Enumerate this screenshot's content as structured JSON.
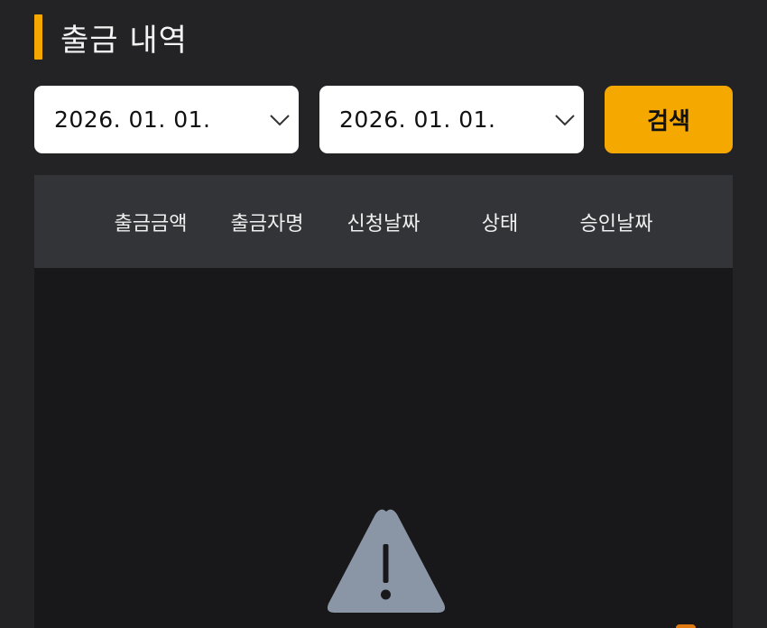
{
  "header": {
    "title": "출금 내역",
    "accent_color": "#f5a800"
  },
  "filters": {
    "start_date": "2026. 01. 01.",
    "end_date": "2026. 01. 01.",
    "dropdown_icon": "chevron-down-icon",
    "search_label": "검색"
  },
  "table": {
    "columns": [
      "출금금액",
      "출금자명",
      "신청날짜",
      "상태",
      "승인날짜"
    ],
    "rows": [],
    "empty_icon": "warning-icon"
  },
  "colors": {
    "background": "#232326",
    "header_background": "#333438",
    "body_background": "#18181a",
    "warning_icon": "#8a96a6"
  }
}
